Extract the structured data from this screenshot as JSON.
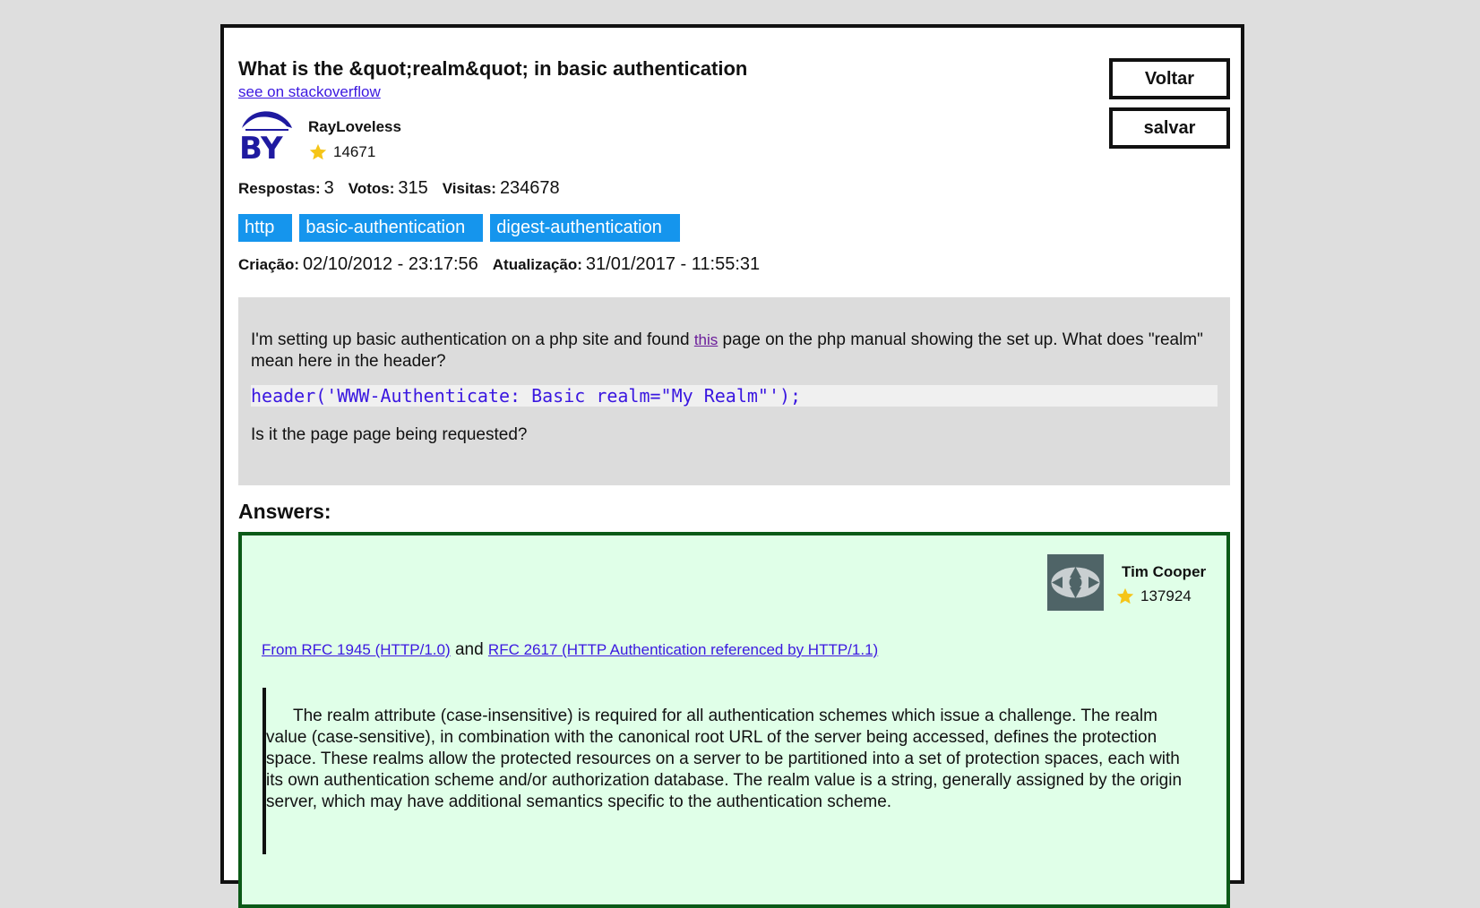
{
  "question": {
    "title": "What is the &quot;realm&quot; in basic authentication",
    "source_link": "see on stackoverflow",
    "author": {
      "name": "RayLoveless",
      "reputation": "14671",
      "avatar_text": "BY"
    },
    "stats": {
      "answers_label": "Respostas:",
      "answers": "3",
      "votes_label": "Votos:",
      "votes": "315",
      "views_label": "Visitas:",
      "views": "234678"
    },
    "tags": [
      "http",
      "basic-authentication",
      "digest-authentication"
    ],
    "dates": {
      "created_label": "Criação:",
      "created": "02/10/2012 - 23:17:56",
      "updated_label": "Atualização:",
      "updated": "31/01/2017 - 11:55:31"
    },
    "body": {
      "before_link": "I'm setting up basic authentication on a php site and found ",
      "link_text": "this",
      "after_link": " page on the php manual showing the set up. What does \"realm\" mean here in the header?",
      "code": "header('WWW-Authenticate: Basic realm=\"My Realm\"');",
      "closing": "Is it the page page being requested?"
    }
  },
  "buttons": {
    "back": "Voltar",
    "save": "salvar"
  },
  "answers_heading": "Answers:",
  "answer": {
    "author": {
      "name": "Tim Cooper",
      "reputation": "137924"
    },
    "link1": "From RFC 1945 (HTTP/1.0)",
    "connector": "and",
    "link2": "RFC 2617 (HTTP Authentication referenced by HTTP/1.1)",
    "quote": "The realm attribute (case-insensitive) is required for all authentication schemes which issue a challenge. The realm value (case-sensitive), in combination with the canonical root URL of the server being accessed, defines the protection space. These realms allow the protected resources on a server to be partitioned into a set of protection spaces, each with its own authentication scheme and/or authorization database. The realm value is a string, generally assigned by the origin server, which may have additional semantics specific to the authentication scheme."
  },
  "colors": {
    "tag_bg": "#1595ed",
    "answer_bg": "#e0ffe8",
    "answer_border": "#0b5a17",
    "link": "#3a17e0",
    "star": "#f5c518"
  }
}
